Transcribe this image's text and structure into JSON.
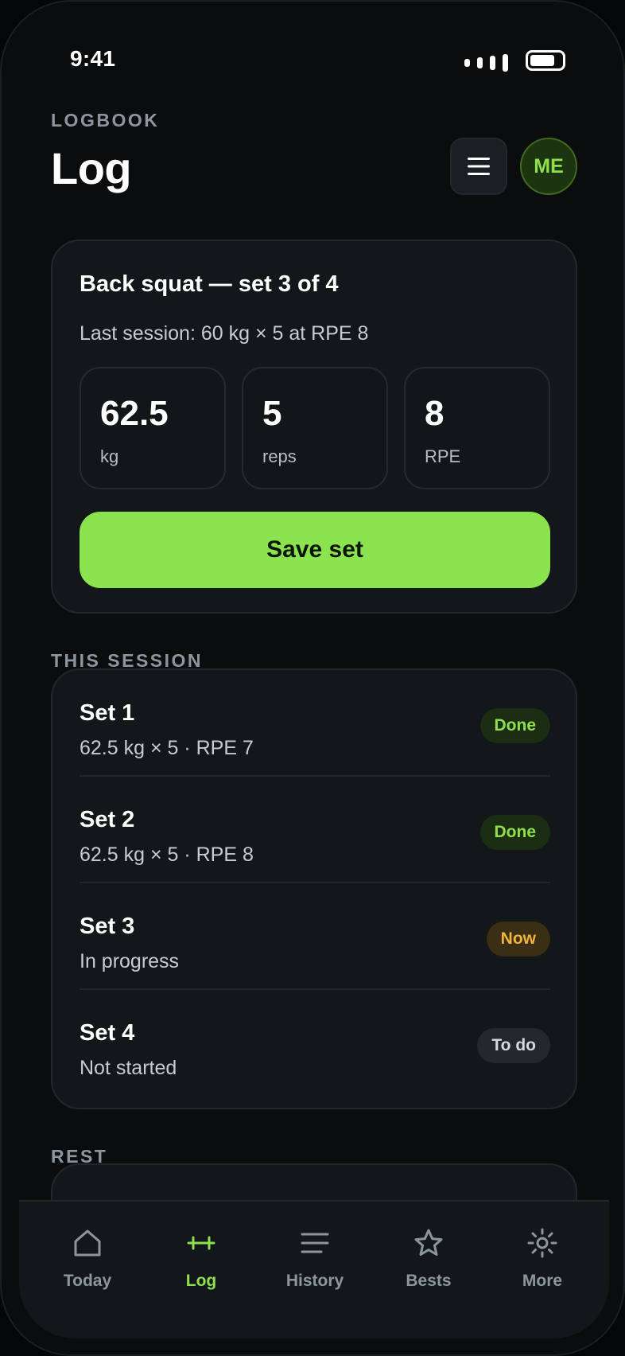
{
  "status": {
    "time": "9:41"
  },
  "header": {
    "eyebrow": "LOGBOOK",
    "title": "Log",
    "avatar_initials": "ME"
  },
  "entry": {
    "title": "Back squat — set 3 of 4",
    "subtitle": "Last session: 60 kg × 5 at RPE 8",
    "metrics": [
      {
        "value": "62.5",
        "unit": "kg"
      },
      {
        "value": "5",
        "unit": "reps"
      },
      {
        "value": "8",
        "unit": "RPE"
      }
    ],
    "save_label": "Save set"
  },
  "session": {
    "label": "THIS SESSION",
    "sets": [
      {
        "name": "Set 1",
        "detail": "62.5 kg × 5 · RPE 7",
        "status": "Done"
      },
      {
        "name": "Set 2",
        "detail": "62.5 kg × 5 · RPE 8",
        "status": "Done"
      },
      {
        "name": "Set 3",
        "detail": "In progress",
        "status": "Now"
      },
      {
        "name": "Set 4",
        "detail": "Not started",
        "status": "To do"
      }
    ]
  },
  "rest": {
    "label": "REST"
  },
  "tabs": [
    {
      "label": "Today",
      "icon": "home-icon"
    },
    {
      "label": "Log",
      "icon": "barbell-icon",
      "active": true
    },
    {
      "label": "History",
      "icon": "list-icon"
    },
    {
      "label": "Bests",
      "icon": "star-icon"
    },
    {
      "label": "More",
      "icon": "gear-icon"
    }
  ],
  "colors": {
    "accent": "#8ae34f",
    "now": "#f0b43c",
    "background": "#0b0c0e",
    "card": "#14171a"
  }
}
